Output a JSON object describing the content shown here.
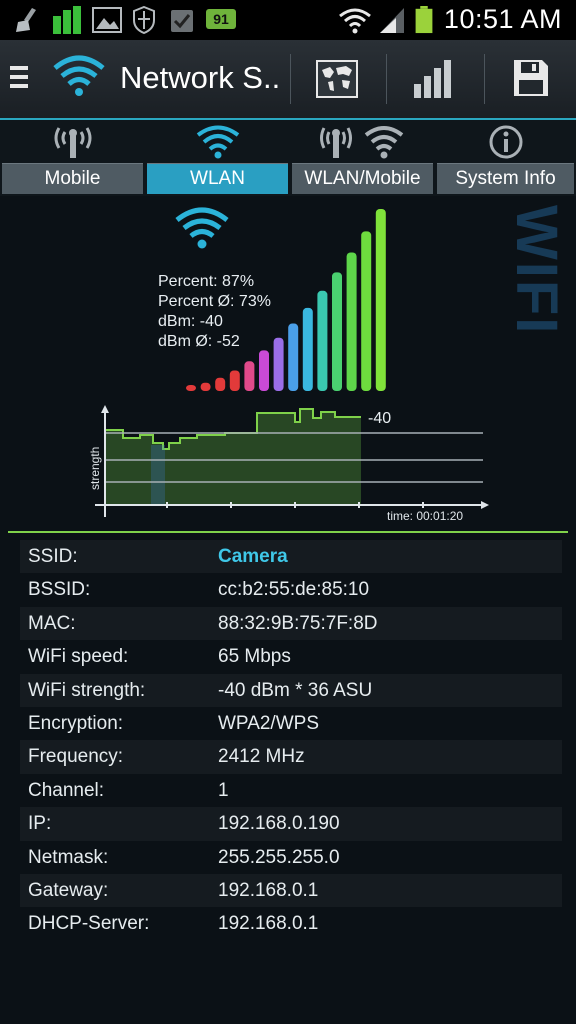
{
  "status_bar": {
    "time": "10:51 AM",
    "battery_badge": "91",
    "icons": [
      "broom-icon",
      "signal-bars-icon",
      "image-icon",
      "shield-icon",
      "check-icon",
      "battery-badge-icon",
      "wifi-icon",
      "cell-signal-icon",
      "battery-icon"
    ]
  },
  "action_bar": {
    "title": "Network S..",
    "icons": [
      "menu-icon",
      "wifi-logo-icon",
      "world-map-icon",
      "signal-bars-icon",
      "save-icon"
    ]
  },
  "tabs": [
    {
      "label": "Mobile",
      "icon": "antenna-icon",
      "active": false
    },
    {
      "label": "WLAN",
      "icon": "wifi-icon",
      "active": true
    },
    {
      "label": "WLAN/Mobile",
      "icon": "antenna-wifi-icon",
      "active": false
    },
    {
      "label": "System Info",
      "icon": "info-icon",
      "active": false
    }
  ],
  "watermark": "WIFI",
  "stats": {
    "percent": "Percent: 87%",
    "percent_avg": "Percent Ø: 73%",
    "dbm": "dBm: -40",
    "dbm_avg": "dBm Ø: -52"
  },
  "signal_meter": {
    "level_fraction": 0.87,
    "bar_count": 14
  },
  "graph": {
    "ylabel": "strength",
    "current_value": "-40",
    "time_label": "time: 00:01:20"
  },
  "info": [
    {
      "key": "SSID:",
      "value": "Camera"
    },
    {
      "key": "BSSID:",
      "value": "cc:b2:55:de:85:10"
    },
    {
      "key": "MAC:",
      "value": "88:32:9B:75:7F:8D"
    },
    {
      "key": "WiFi speed:",
      "value": "65 Mbps"
    },
    {
      "key": "WiFi strength:",
      "value": "-40 dBm * 36 ASU"
    },
    {
      "key": "Encryption:",
      "value": "WPA2/WPS"
    },
    {
      "key": "Frequency:",
      "value": "2412 MHz"
    },
    {
      "key": "Channel:",
      "value": "1"
    },
    {
      "key": "IP:",
      "value": "192.168.0.190"
    },
    {
      "key": "Netmask:",
      "value": "255.255.255.0"
    },
    {
      "key": "Gateway:",
      "value": "192.168.0.1"
    },
    {
      "key": "DHCP-Server:",
      "value": "192.168.0.1"
    }
  ],
  "colors": {
    "accent": "#2a9fc2",
    "ssid": "#3fc8e8",
    "graph_line": "#7fd14a"
  }
}
